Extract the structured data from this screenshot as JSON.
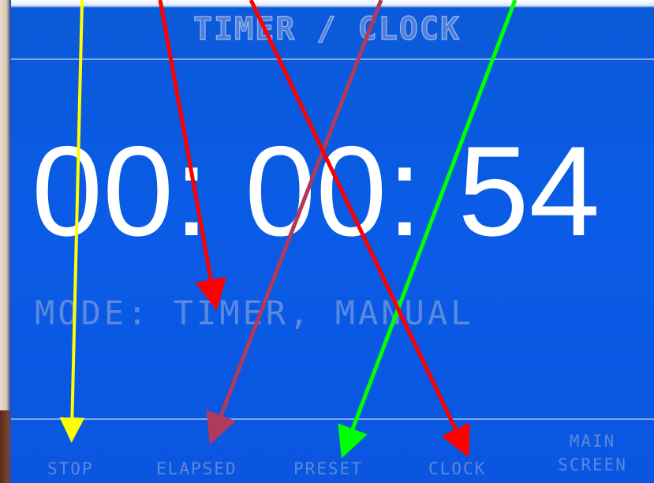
{
  "screen": {
    "title": "TIMER / CLOCK",
    "time_display": "00: 00: 54",
    "mode_line": "MODE: TIMER, MANUAL"
  },
  "softkeys": {
    "stop": "STOP",
    "elapsed": "ELAPSED",
    "preset": "PRESET",
    "clock": "CLOCK",
    "main_screen_line1": "MAIN",
    "main_screen_line2": "SCREEN"
  },
  "annotation_arrows": [
    {
      "color": "#ffff00",
      "points_to": "stop"
    },
    {
      "color": "#ff0000",
      "points_to": "mode_line"
    },
    {
      "color": "#b03a5b",
      "points_to": "elapsed"
    },
    {
      "color": "#00ff00",
      "points_to": "preset"
    },
    {
      "color": "#ff0000",
      "points_to": "clock"
    }
  ],
  "colors": {
    "screen_background": "#0a56e0",
    "primary_text": "#ffffff",
    "dim_text": "#5d88da"
  }
}
